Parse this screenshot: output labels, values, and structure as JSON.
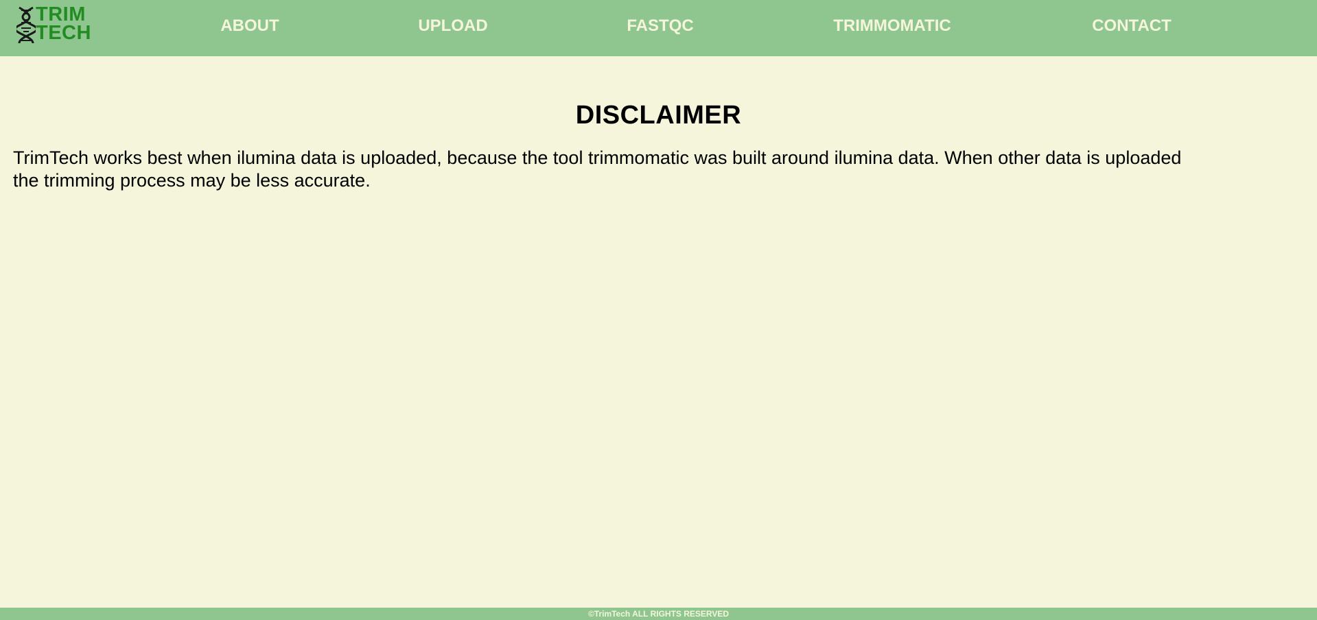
{
  "logo": {
    "line1": "TRIM",
    "line2": "TECH",
    "icon": "dna-helix-icon",
    "color": "#228b22"
  },
  "nav": {
    "items": [
      {
        "label": "ABOUT"
      },
      {
        "label": "UPLOAD"
      },
      {
        "label": "FASTQC"
      },
      {
        "label": "TRIMMOMATIC"
      },
      {
        "label": "CONTACT"
      }
    ]
  },
  "main": {
    "title": "DISCLAIMER",
    "body": "TrimTech works best when ilumina data is uploaded, because the tool trimmomatic was built around ilumina data. When other data is uploaded the trimming process may be less accurate."
  },
  "footer": {
    "text": "©TrimTech ALL RIGHTS RESERVED"
  },
  "colors": {
    "navbar": "#8fc68f",
    "background": "#f5f5dc",
    "nav_text": "#f5f5dc",
    "logo_text": "#228b22"
  }
}
